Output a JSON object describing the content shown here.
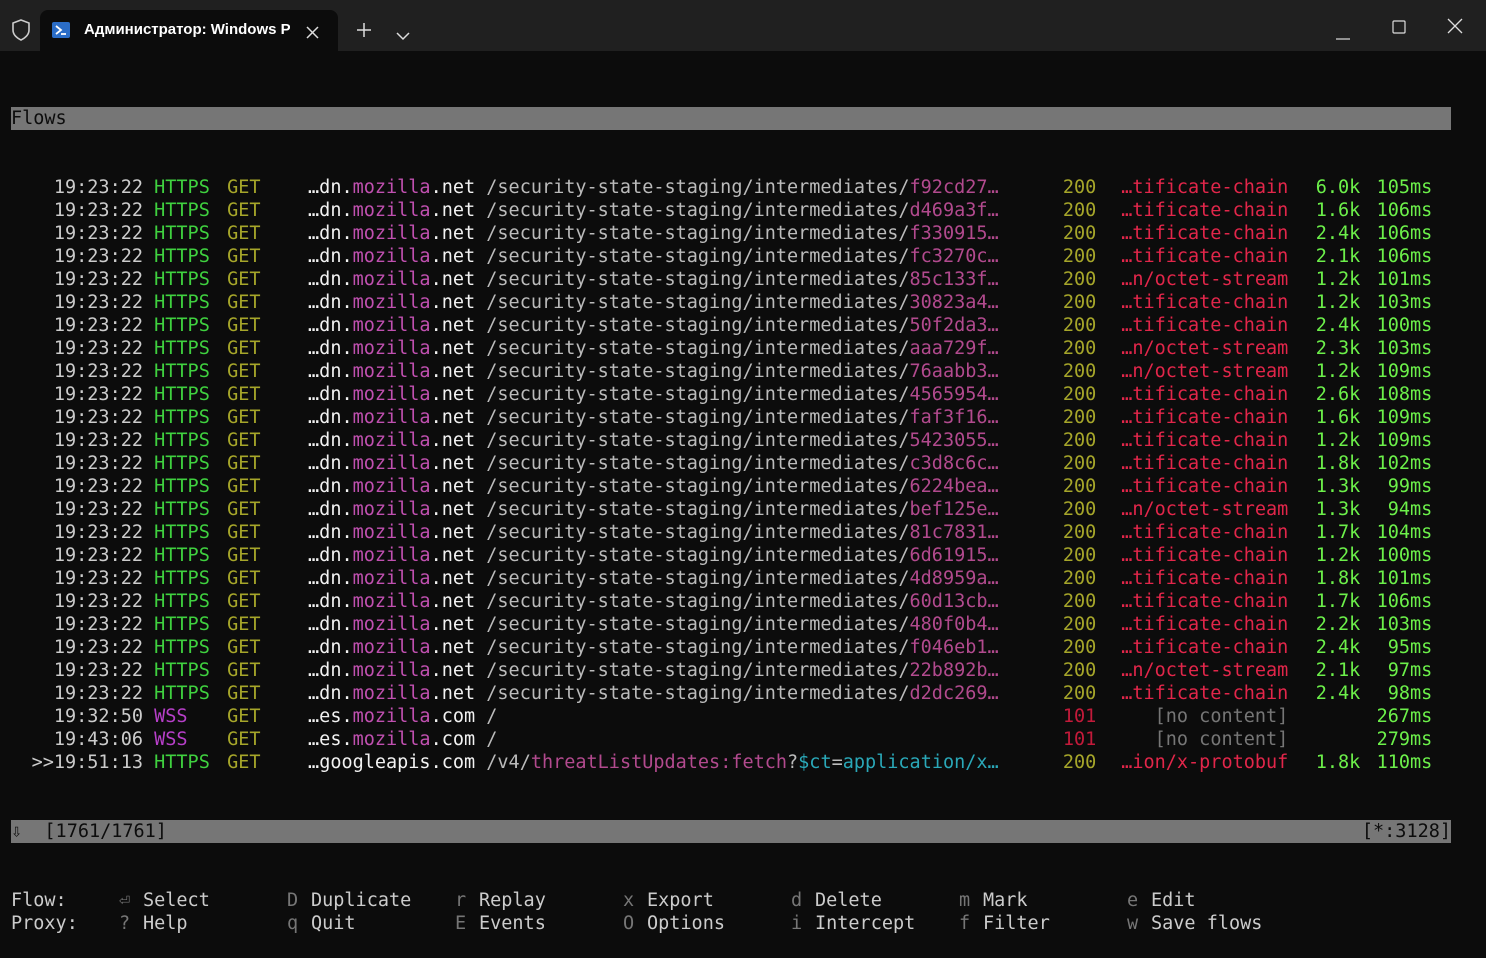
{
  "window": {
    "tab_title": "Администратор: Windows PowerShell",
    "new_tab_label": "+",
    "colors": {
      "titlebar": "#202020",
      "terminal_bg": "#0c0c0c",
      "bar_gray": "#767676"
    }
  },
  "terminal": {
    "header": "Flows",
    "rows": [
      {
        "prefix": "  ",
        "time": "19:23:22",
        "scheme": "HTTPS",
        "method": "GET",
        "host_pre": "…dn.",
        "host_mid": "mozilla",
        "host_post": ".net",
        "path": "/security-state-staging/intermediates/",
        "hash": "f92cd27…",
        "code": "200",
        "type": "…tificate-chain",
        "size": "6.0k",
        "dur": "105ms"
      },
      {
        "prefix": "  ",
        "time": "19:23:22",
        "scheme": "HTTPS",
        "method": "GET",
        "host_pre": "…dn.",
        "host_mid": "mozilla",
        "host_post": ".net",
        "path": "/security-state-staging/intermediates/",
        "hash": "d469a3f…",
        "code": "200",
        "type": "…tificate-chain",
        "size": "1.6k",
        "dur": "106ms"
      },
      {
        "prefix": "  ",
        "time": "19:23:22",
        "scheme": "HTTPS",
        "method": "GET",
        "host_pre": "…dn.",
        "host_mid": "mozilla",
        "host_post": ".net",
        "path": "/security-state-staging/intermediates/",
        "hash": "f330915…",
        "code": "200",
        "type": "…tificate-chain",
        "size": "2.4k",
        "dur": "106ms"
      },
      {
        "prefix": "  ",
        "time": "19:23:22",
        "scheme": "HTTPS",
        "method": "GET",
        "host_pre": "…dn.",
        "host_mid": "mozilla",
        "host_post": ".net",
        "path": "/security-state-staging/intermediates/",
        "hash": "fc3270c…",
        "code": "200",
        "type": "…tificate-chain",
        "size": "2.1k",
        "dur": "106ms"
      },
      {
        "prefix": "  ",
        "time": "19:23:22",
        "scheme": "HTTPS",
        "method": "GET",
        "host_pre": "…dn.",
        "host_mid": "mozilla",
        "host_post": ".net",
        "path": "/security-state-staging/intermediates/",
        "hash": "85c133f…",
        "code": "200",
        "type": "…n/octet-stream",
        "size": "1.2k",
        "dur": "101ms"
      },
      {
        "prefix": "  ",
        "time": "19:23:22",
        "scheme": "HTTPS",
        "method": "GET",
        "host_pre": "…dn.",
        "host_mid": "mozilla",
        "host_post": ".net",
        "path": "/security-state-staging/intermediates/",
        "hash": "30823a4…",
        "code": "200",
        "type": "…tificate-chain",
        "size": "1.2k",
        "dur": "103ms"
      },
      {
        "prefix": "  ",
        "time": "19:23:22",
        "scheme": "HTTPS",
        "method": "GET",
        "host_pre": "…dn.",
        "host_mid": "mozilla",
        "host_post": ".net",
        "path": "/security-state-staging/intermediates/",
        "hash": "50f2da3…",
        "code": "200",
        "type": "…tificate-chain",
        "size": "2.4k",
        "dur": "100ms"
      },
      {
        "prefix": "  ",
        "time": "19:23:22",
        "scheme": "HTTPS",
        "method": "GET",
        "host_pre": "…dn.",
        "host_mid": "mozilla",
        "host_post": ".net",
        "path": "/security-state-staging/intermediates/",
        "hash": "aaa729f…",
        "code": "200",
        "type": "…n/octet-stream",
        "size": "2.3k",
        "dur": "103ms"
      },
      {
        "prefix": "  ",
        "time": "19:23:22",
        "scheme": "HTTPS",
        "method": "GET",
        "host_pre": "…dn.",
        "host_mid": "mozilla",
        "host_post": ".net",
        "path": "/security-state-staging/intermediates/",
        "hash": "76aabb3…",
        "code": "200",
        "type": "…n/octet-stream",
        "size": "1.2k",
        "dur": "109ms"
      },
      {
        "prefix": "  ",
        "time": "19:23:22",
        "scheme": "HTTPS",
        "method": "GET",
        "host_pre": "…dn.",
        "host_mid": "mozilla",
        "host_post": ".net",
        "path": "/security-state-staging/intermediates/",
        "hash": "4565954…",
        "code": "200",
        "type": "…tificate-chain",
        "size": "2.6k",
        "dur": "108ms"
      },
      {
        "prefix": "  ",
        "time": "19:23:22",
        "scheme": "HTTPS",
        "method": "GET",
        "host_pre": "…dn.",
        "host_mid": "mozilla",
        "host_post": ".net",
        "path": "/security-state-staging/intermediates/",
        "hash": "faf3f16…",
        "code": "200",
        "type": "…tificate-chain",
        "size": "1.6k",
        "dur": "109ms"
      },
      {
        "prefix": "  ",
        "time": "19:23:22",
        "scheme": "HTTPS",
        "method": "GET",
        "host_pre": "…dn.",
        "host_mid": "mozilla",
        "host_post": ".net",
        "path": "/security-state-staging/intermediates/",
        "hash": "5423055…",
        "code": "200",
        "type": "…tificate-chain",
        "size": "1.2k",
        "dur": "109ms"
      },
      {
        "prefix": "  ",
        "time": "19:23:22",
        "scheme": "HTTPS",
        "method": "GET",
        "host_pre": "…dn.",
        "host_mid": "mozilla",
        "host_post": ".net",
        "path": "/security-state-staging/intermediates/",
        "hash": "c3d8c6c…",
        "code": "200",
        "type": "…tificate-chain",
        "size": "1.8k",
        "dur": "102ms"
      },
      {
        "prefix": "  ",
        "time": "19:23:22",
        "scheme": "HTTPS",
        "method": "GET",
        "host_pre": "…dn.",
        "host_mid": "mozilla",
        "host_post": ".net",
        "path": "/security-state-staging/intermediates/",
        "hash": "6224bea…",
        "code": "200",
        "type": "…tificate-chain",
        "size": "1.3k",
        "dur": "99ms"
      },
      {
        "prefix": "  ",
        "time": "19:23:22",
        "scheme": "HTTPS",
        "method": "GET",
        "host_pre": "…dn.",
        "host_mid": "mozilla",
        "host_post": ".net",
        "path": "/security-state-staging/intermediates/",
        "hash": "bef125e…",
        "code": "200",
        "type": "…n/octet-stream",
        "size": "1.3k",
        "dur": "94ms"
      },
      {
        "prefix": "  ",
        "time": "19:23:22",
        "scheme": "HTTPS",
        "method": "GET",
        "host_pre": "…dn.",
        "host_mid": "mozilla",
        "host_post": ".net",
        "path": "/security-state-staging/intermediates/",
        "hash": "81c7831…",
        "code": "200",
        "type": "…tificate-chain",
        "size": "1.7k",
        "dur": "104ms"
      },
      {
        "prefix": "  ",
        "time": "19:23:22",
        "scheme": "HTTPS",
        "method": "GET",
        "host_pre": "…dn.",
        "host_mid": "mozilla",
        "host_post": ".net",
        "path": "/security-state-staging/intermediates/",
        "hash": "6d61915…",
        "code": "200",
        "type": "…tificate-chain",
        "size": "1.2k",
        "dur": "100ms"
      },
      {
        "prefix": "  ",
        "time": "19:23:22",
        "scheme": "HTTPS",
        "method": "GET",
        "host_pre": "…dn.",
        "host_mid": "mozilla",
        "host_post": ".net",
        "path": "/security-state-staging/intermediates/",
        "hash": "4d8959a…",
        "code": "200",
        "type": "…tificate-chain",
        "size": "1.8k",
        "dur": "101ms"
      },
      {
        "prefix": "  ",
        "time": "19:23:22",
        "scheme": "HTTPS",
        "method": "GET",
        "host_pre": "…dn.",
        "host_mid": "mozilla",
        "host_post": ".net",
        "path": "/security-state-staging/intermediates/",
        "hash": "60d13cb…",
        "code": "200",
        "type": "…tificate-chain",
        "size": "1.7k",
        "dur": "106ms"
      },
      {
        "prefix": "  ",
        "time": "19:23:22",
        "scheme": "HTTPS",
        "method": "GET",
        "host_pre": "…dn.",
        "host_mid": "mozilla",
        "host_post": ".net",
        "path": "/security-state-staging/intermediates/",
        "hash": "480f0b4…",
        "code": "200",
        "type": "…tificate-chain",
        "size": "2.2k",
        "dur": "103ms"
      },
      {
        "prefix": "  ",
        "time": "19:23:22",
        "scheme": "HTTPS",
        "method": "GET",
        "host_pre": "…dn.",
        "host_mid": "mozilla",
        "host_post": ".net",
        "path": "/security-state-staging/intermediates/",
        "hash": "f046eb1…",
        "code": "200",
        "type": "…tificate-chain",
        "size": "2.4k",
        "dur": "95ms"
      },
      {
        "prefix": "  ",
        "time": "19:23:22",
        "scheme": "HTTPS",
        "method": "GET",
        "host_pre": "…dn.",
        "host_mid": "mozilla",
        "host_post": ".net",
        "path": "/security-state-staging/intermediates/",
        "hash": "22b892b…",
        "code": "200",
        "type": "…n/octet-stream",
        "size": "2.1k",
        "dur": "97ms"
      },
      {
        "prefix": "  ",
        "time": "19:23:22",
        "scheme": "HTTPS",
        "method": "GET",
        "host_pre": "…dn.",
        "host_mid": "mozilla",
        "host_post": ".net",
        "path": "/security-state-staging/intermediates/",
        "hash": "d2dc269…",
        "code": "200",
        "type": "…tificate-chain",
        "size": "2.4k",
        "dur": "98ms"
      },
      {
        "prefix": "  ",
        "time": "19:32:50",
        "scheme": "WSS",
        "method": "GET",
        "host_pre": "…es.",
        "host_mid": "mozilla",
        "host_post": ".com",
        "path": "/",
        "hash": "",
        "code": "101",
        "type": "[no content]",
        "size": "",
        "dur": "267ms"
      },
      {
        "prefix": "  ",
        "time": "19:43:06",
        "scheme": "WSS",
        "method": "GET",
        "host_pre": "…es.",
        "host_mid": "mozilla",
        "host_post": ".com",
        "path": "/",
        "hash": "",
        "code": "101",
        "type": "[no content]",
        "size": "",
        "dur": "279ms"
      },
      {
        "prefix": ">>",
        "time": "19:51:13",
        "scheme": "HTTPS",
        "method": "GET",
        "host_pre": "…",
        "host_mid": "googleapis",
        "host_post": ".com",
        "path": "/v4/",
        "hash": "threatListUpdates:fetch",
        "query_sep": "?",
        "query_key": "$ct",
        "query_eq": "=",
        "query_val": "application/x…",
        "code": "200",
        "type": "…ion/x-protobuf",
        "size": "1.8k",
        "dur": "110ms"
      }
    ],
    "status_left": "⇩  [1761/1761]",
    "status_right": "[*:3128]",
    "keybar": [
      {
        "label": "Flow:",
        "items": [
          {
            "key": "⏎",
            "name": "Select"
          },
          {
            "key": "D",
            "name": "Duplicate"
          },
          {
            "key": "r",
            "name": "Replay"
          },
          {
            "key": "x",
            "name": "Export"
          },
          {
            "key": "d",
            "name": "Delete"
          },
          {
            "key": "m",
            "name": "Mark"
          },
          {
            "key": "e",
            "name": "Edit"
          }
        ]
      },
      {
        "label": "Proxy:",
        "items": [
          {
            "key": "?",
            "name": "Help"
          },
          {
            "key": "q",
            "name": "Quit"
          },
          {
            "key": "E",
            "name": "Events"
          },
          {
            "key": "O",
            "name": "Options"
          },
          {
            "key": "i",
            "name": "Intercept"
          },
          {
            "key": "f",
            "name": "Filter"
          },
          {
            "key": "w",
            "name": "Save flows"
          }
        ]
      }
    ]
  }
}
